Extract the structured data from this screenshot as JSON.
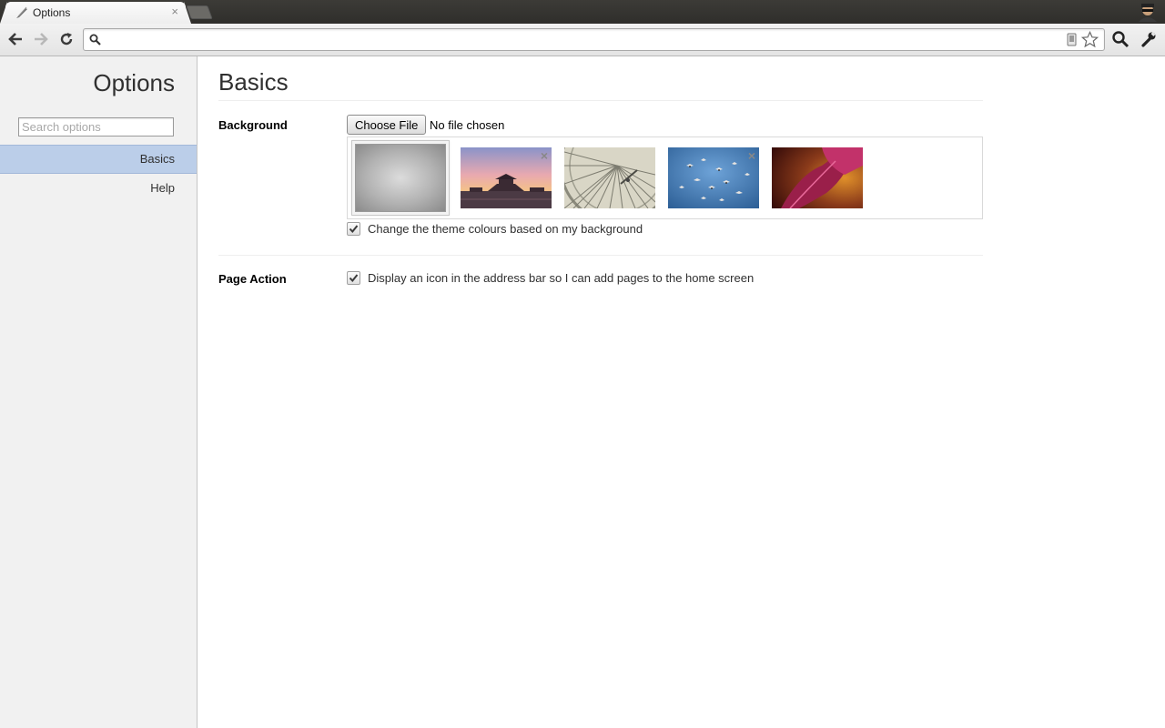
{
  "window": {
    "tab_title": "Options",
    "tab_close": "×"
  },
  "toolbar": {
    "omnibox_value": ""
  },
  "sidebar": {
    "title": "Options",
    "search_placeholder": "Search options",
    "items": [
      {
        "label": "Basics",
        "selected": true
      },
      {
        "label": "Help",
        "selected": false
      }
    ]
  },
  "main": {
    "title": "Basics",
    "background": {
      "label": "Background",
      "choose_file_label": "Choose File",
      "file_status": "No file chosen",
      "thumbnails": [
        {
          "name": "default-gray",
          "selected": true
        },
        {
          "name": "sunset-palace",
          "removable": true
        },
        {
          "name": "ferris-wheel",
          "removable": false
        },
        {
          "name": "birds-sky",
          "removable": true
        },
        {
          "name": "red-leaf",
          "removable": false
        }
      ],
      "remove_glyph": "×",
      "theme_checkbox_label": "Change the theme colours based on my background",
      "theme_checkbox_checked": true
    },
    "page_action": {
      "label": "Page Action",
      "checkbox_label": "Display an icon in the address bar so I can add pages to the home screen",
      "checkbox_checked": true
    }
  },
  "colors": {
    "selected_nav": "#bbcee9",
    "sidebar_bg": "#f1f1f1",
    "tabstrip": "#3c3b37"
  }
}
